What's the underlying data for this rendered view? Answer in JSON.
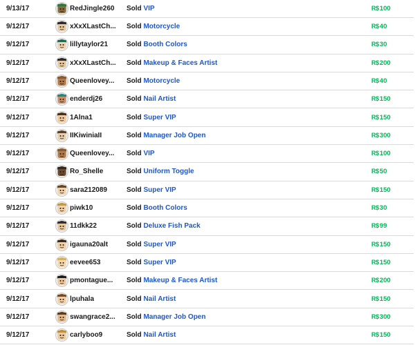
{
  "sales": [
    {
      "date": "9/13/17",
      "user": "RedJingle260",
      "action": "Sold",
      "item": "VIP",
      "currency": "R$",
      "amount": "100",
      "avatar": {
        "skin": "#8a6a3c",
        "hair": "#2f7a3b",
        "bg": "#dfe9dd"
      }
    },
    {
      "date": "9/12/17",
      "user": "xXxXLastCh...",
      "action": "Sold",
      "item": "Motorcycle",
      "currency": "R$",
      "amount": "40",
      "avatar": {
        "skin": "#e7c9a0",
        "hair": "#2b2b2b",
        "bg": "#ededed"
      }
    },
    {
      "date": "9/12/17",
      "user": "lillytaylor21",
      "action": "Sold",
      "item": "Booth Colors",
      "currency": "R$",
      "amount": "30",
      "avatar": {
        "skin": "#f1d3b0",
        "hair": "#1f6b56",
        "bg": "#e6efe9"
      }
    },
    {
      "date": "9/12/17",
      "user": "xXxXLastCh...",
      "action": "Sold",
      "item": "Makeup & Faces Artist",
      "currency": "R$",
      "amount": "200",
      "avatar": {
        "skin": "#e7c9a0",
        "hair": "#2b2b2b",
        "bg": "#ededed"
      }
    },
    {
      "date": "9/12/17",
      "user": "Queenlovey...",
      "action": "Sold",
      "item": "Motorcycle",
      "currency": "R$",
      "amount": "40",
      "avatar": {
        "skin": "#b07b4c",
        "hair": "#8a5a32",
        "bg": "#efe3d5"
      }
    },
    {
      "date": "9/12/17",
      "user": "enderdj26",
      "action": "Sold",
      "item": "Nail Artist",
      "currency": "R$",
      "amount": "150",
      "avatar": {
        "skin": "#c98d6a",
        "hair": "#1d8a7a",
        "bg": "#e5eeec"
      }
    },
    {
      "date": "9/12/17",
      "user": "1Alna1",
      "action": "Sold",
      "item": "Super VIP",
      "currency": "R$",
      "amount": "150",
      "avatar": {
        "skin": "#f0c89a",
        "hair": "#4a2f1c",
        "bg": "#f0e8dc"
      }
    },
    {
      "date": "9/12/17",
      "user": "IIKiwiniaII",
      "action": "Sold",
      "item": "Manager Job Open",
      "currency": "R$",
      "amount": "300",
      "avatar": {
        "skin": "#e8cfae",
        "hair": "#5b4126",
        "bg": "#f1ebe2"
      }
    },
    {
      "date": "9/12/17",
      "user": "Queenlovey...",
      "action": "Sold",
      "item": "VIP",
      "currency": "R$",
      "amount": "100",
      "avatar": {
        "skin": "#b07b4c",
        "hair": "#8a5a32",
        "bg": "#efe3d5"
      }
    },
    {
      "date": "9/12/17",
      "user": "Ro_Shelle",
      "action": "Sold",
      "item": "Uniform Toggle",
      "currency": "R$",
      "amount": "50",
      "avatar": {
        "skin": "#6b4a2e",
        "hair": "#3a2818",
        "bg": "#eeeeee"
      }
    },
    {
      "date": "9/12/17",
      "user": "sara212089",
      "action": "Sold",
      "item": "Super VIP",
      "currency": "R$",
      "amount": "150",
      "avatar": {
        "skin": "#f0d2ad",
        "hair": "#6a4422",
        "bg": "#f3ece3"
      }
    },
    {
      "date": "9/12/17",
      "user": "piwk10",
      "action": "Sold",
      "item": "Booth Colors",
      "currency": "R$",
      "amount": "30",
      "avatar": {
        "skin": "#f2d0a8",
        "hair": "#c59a3a",
        "bg": "#f4eddf"
      }
    },
    {
      "date": "9/12/17",
      "user": "11dkk22",
      "action": "Sold",
      "item": "Deluxe Fish Pack",
      "currency": "R$",
      "amount": "99",
      "avatar": {
        "skin": "#e7c79d",
        "hair": "#2f2f2f",
        "bg": "#eeeeee"
      }
    },
    {
      "date": "9/12/17",
      "user": "igauna20alt",
      "action": "Sold",
      "item": "Super VIP",
      "currency": "R$",
      "amount": "150",
      "avatar": {
        "skin": "#efcfa6",
        "hair": "#3e2a1a",
        "bg": "#f0e9df"
      }
    },
    {
      "date": "9/12/17",
      "user": "eevee653",
      "action": "Sold",
      "item": "Super VIP",
      "currency": "R$",
      "amount": "150",
      "avatar": {
        "skin": "#f4d6b0",
        "hair": "#d8b15c",
        "bg": "#f5efe2"
      }
    },
    {
      "date": "9/12/17",
      "user": "pmontague...",
      "action": "Sold",
      "item": "Makeup & Faces Artist",
      "currency": "R$",
      "amount": "200",
      "avatar": {
        "skin": "#efc9a0",
        "hair": "#1c1c1c",
        "bg": "#ececec"
      }
    },
    {
      "date": "9/12/17",
      "user": "lpuhala",
      "action": "Sold",
      "item": "Nail Artist",
      "currency": "R$",
      "amount": "150",
      "avatar": {
        "skin": "#f0cfa8",
        "hair": "#7a4a22",
        "bg": "#f3ebe0"
      }
    },
    {
      "date": "9/12/17",
      "user": "swangrace2...",
      "action": "Sold",
      "item": "Manager Job Open",
      "currency": "R$",
      "amount": "300",
      "avatar": {
        "skin": "#e2b98c",
        "hair": "#5a3b1e",
        "bg": "#f0e6da"
      }
    },
    {
      "date": "9/12/17",
      "user": "carlyboo9",
      "action": "Sold",
      "item": "Nail Artist",
      "currency": "R$",
      "amount": "150",
      "avatar": {
        "skin": "#edc9a0",
        "hair": "#c2902e",
        "bg": "#f3ecdf"
      }
    }
  ]
}
